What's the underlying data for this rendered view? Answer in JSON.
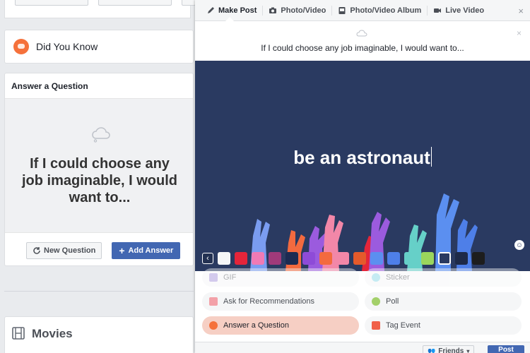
{
  "feed": {
    "did_you_know": {
      "title": "Did You Know"
    },
    "answer_card": {
      "header": "Answer a Question",
      "question": "If I could choose any job imaginable, I would want to...",
      "new_question_label": "New Question",
      "add_answer_label": "Add Answer"
    },
    "movies": {
      "title": "Movies"
    }
  },
  "composer": {
    "tabs": [
      {
        "label": "Make Post",
        "icon": "pencil-icon"
      },
      {
        "label": "Photo/Video",
        "icon": "camera-icon"
      },
      {
        "label": "Photo/Video Album",
        "icon": "album-icon"
      },
      {
        "label": "Live Video",
        "icon": "video-camera-icon"
      }
    ],
    "close_glyph": "×",
    "prompt": "If I could choose any job imaginable, I would want to...",
    "prompt_close_glyph": "×",
    "answer": "be an astronaut",
    "background_color": "#2a3a61",
    "swatches": [
      "#f5f6f7",
      "#e4253a",
      "#f07ab5",
      "#a03a7a",
      "#1c2b52",
      "#8e4bd8",
      "#f36a3f",
      "#f287a8",
      "#e45a2b",
      "#5b8ff0",
      "#4e7fe8",
      "#66d0c8",
      "#9bd65c",
      "#2a3a61",
      "#1e2a48",
      "#1d1d1d"
    ],
    "selected_swatch_index": 13,
    "prev_glyph": "‹",
    "emoji_glyph": "☺",
    "options": {
      "gif": "GIF",
      "sticker": "Sticker",
      "ask_recommendations": "Ask for Recommendations",
      "poll": "Poll",
      "answer_question": "Answer a Question",
      "tag_event": "Tag Event"
    },
    "audience_label": "Friends",
    "post_label": "Post"
  }
}
